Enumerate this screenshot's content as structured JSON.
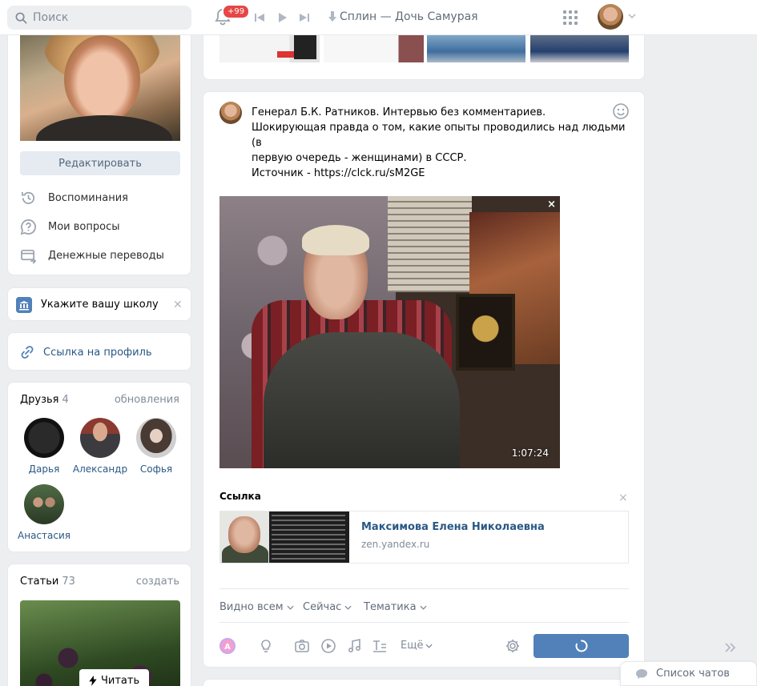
{
  "header": {
    "search_placeholder": "Поиск",
    "notifications_badge": "+99",
    "player_track": "Сплин — Дочь Самурая"
  },
  "left": {
    "edit_button": "Редактировать",
    "menu": [
      {
        "label": "Воспоминания",
        "icon": "history-icon"
      },
      {
        "label": "Мои вопросы",
        "icon": "question-icon"
      },
      {
        "label": "Денежные переводы",
        "icon": "money-transfer-icon"
      }
    ],
    "school_prompt": "Укажите вашу школу",
    "profile_link": "Ссылка на профиль",
    "friends": {
      "title": "Друзья",
      "count": "4",
      "action": "обновления",
      "items": [
        {
          "name": "Дарья"
        },
        {
          "name": "Александр"
        },
        {
          "name": "Софья"
        },
        {
          "name": "Анастасия"
        }
      ]
    },
    "articles": {
      "title": "Статьи",
      "count": "73",
      "action": "создать",
      "read_button": "Читать"
    }
  },
  "post": {
    "lines": [
      "Генерал Б.К. Ратников. Интервью без комментариев.",
      "Шокирующая правда о том, какие опыты проводились над людьми (в",
      "первую очередь - женщинами) в СССР.",
      "Источник - https://clck.ru/sM2GE"
    ],
    "video_duration": "1:07:24",
    "video_close": "×",
    "link_section_title": "Ссылка",
    "link_close": "×",
    "snippet": {
      "title": "Максимова Елена Николаевна",
      "domain": "zen.yandex.ru"
    },
    "options": {
      "visibility": "Видно всем",
      "time": "Сейчас",
      "topic": "Тематика"
    },
    "more_label": "Ещё"
  },
  "footer": {
    "chat_list": "Список чатов"
  },
  "colors": {
    "accent": "#5181b8",
    "link": "#2a5885",
    "badge": "#e64646"
  }
}
